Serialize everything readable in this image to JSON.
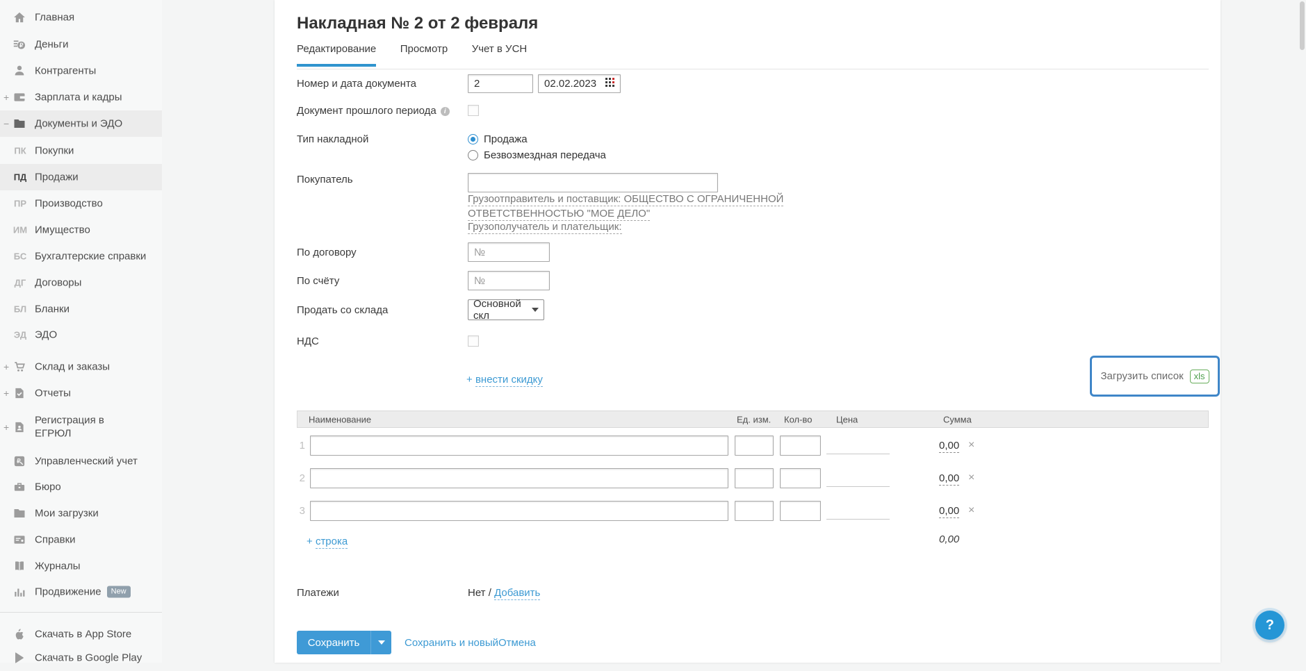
{
  "colors": {
    "accent_blue": "#3d9ad3",
    "tab_underline": "#3094ce",
    "save_button": "#3f9ad6",
    "upload_border": "#3f86c8",
    "xls_green": "#67ad5b",
    "help_button": "#2596d6"
  },
  "sidebar": {
    "items": [
      {
        "label": "Главная",
        "icon": "home-icon"
      },
      {
        "label": "Деньги",
        "icon": "money-icon"
      },
      {
        "label": "Контрагенты",
        "icon": "contractors-icon"
      },
      {
        "label": "Зарплата и кадры",
        "icon": "salary-icon",
        "expand": "+"
      },
      {
        "label": "Документы и ЭДО",
        "icon": "documents-folder-icon",
        "expand": "−"
      }
    ],
    "subitems": [
      {
        "code": "ПК",
        "label": "Покупки"
      },
      {
        "code": "ПД",
        "label": "Продажи"
      },
      {
        "code": "ПР",
        "label": "Производство"
      },
      {
        "code": "ИМ",
        "label": "Имущество"
      },
      {
        "code": "БС",
        "label": "Бухгалтерские справки"
      },
      {
        "code": "ДГ",
        "label": "Договоры"
      },
      {
        "code": "БЛ",
        "label": "Бланки"
      },
      {
        "code": "ЭД",
        "label": "ЭДО"
      }
    ],
    "items2": [
      {
        "label": "Склад и заказы",
        "expand": "+"
      },
      {
        "label": "Отчеты",
        "expand": "+"
      },
      {
        "label": "Регистрация в ЕГРЮЛ",
        "expand": "+"
      },
      {
        "label": "Управленческий учет"
      },
      {
        "label": "Бюро"
      },
      {
        "label": "Мои загрузки"
      },
      {
        "label": "Справки"
      },
      {
        "label": "Журналы"
      },
      {
        "label": "Продвижение",
        "badge": "New"
      }
    ],
    "apps": [
      {
        "label": "Скачать в App Store"
      },
      {
        "label": "Скачать в Google Play"
      }
    ]
  },
  "header": {
    "title": "Накладная № 2 от 2 февраля",
    "tabs": [
      {
        "label": "Редактирование"
      },
      {
        "label": "Просмотр"
      },
      {
        "label": "Учет в УСН"
      }
    ]
  },
  "form": {
    "number_date_label": "Номер и дата документа",
    "number_value": "2",
    "date_value": "02.02.2023",
    "past_period_label": "Документ прошлого периода",
    "type_label": "Тип накладной",
    "type_options": [
      "Продажа",
      "Безвозмездная передача"
    ],
    "buyer_label": "Покупатель",
    "shipper_link_line1": "Грузоотправитель и поставщик: ОБЩЕСТВО С ОГРАНИЧЕННОЙ",
    "shipper_link_line2": "ОТВЕТСТВЕННОСТЬЮ \"МОЕ ДЕЛО\"",
    "consignee_link": "Грузополучатель и плательщик:",
    "contract_label": "По договору",
    "contract_placeholder": "№",
    "invoice_label": "По счёту",
    "invoice_placeholder": "№",
    "warehouse_label": "Продать со склада",
    "warehouse_value": "Основной скл",
    "vat_label": "НДС",
    "discount_plus": "+",
    "discount_link": "внести скидку",
    "upload_button": "Загрузить список",
    "upload_badge": "xls"
  },
  "table": {
    "headers": [
      "Наименование",
      "Ед. изм.",
      "Кол-во",
      "Цена",
      "Сумма"
    ],
    "rows": [
      {
        "num": "1",
        "sum": "0,00",
        "delete": "×"
      },
      {
        "num": "2",
        "sum": "0,00",
        "delete": "×"
      },
      {
        "num": "3",
        "sum": "0,00",
        "delete": "×"
      }
    ],
    "add_row_plus": "+",
    "add_row_link": "строка",
    "total": "0,00"
  },
  "payments": {
    "label": "Платежи",
    "value": "Нет /",
    "add_link": "Добавить"
  },
  "actions": {
    "save": "Сохранить",
    "save_new": "Сохранить и новый",
    "cancel": "Отмена"
  },
  "help": {
    "label": "?"
  }
}
